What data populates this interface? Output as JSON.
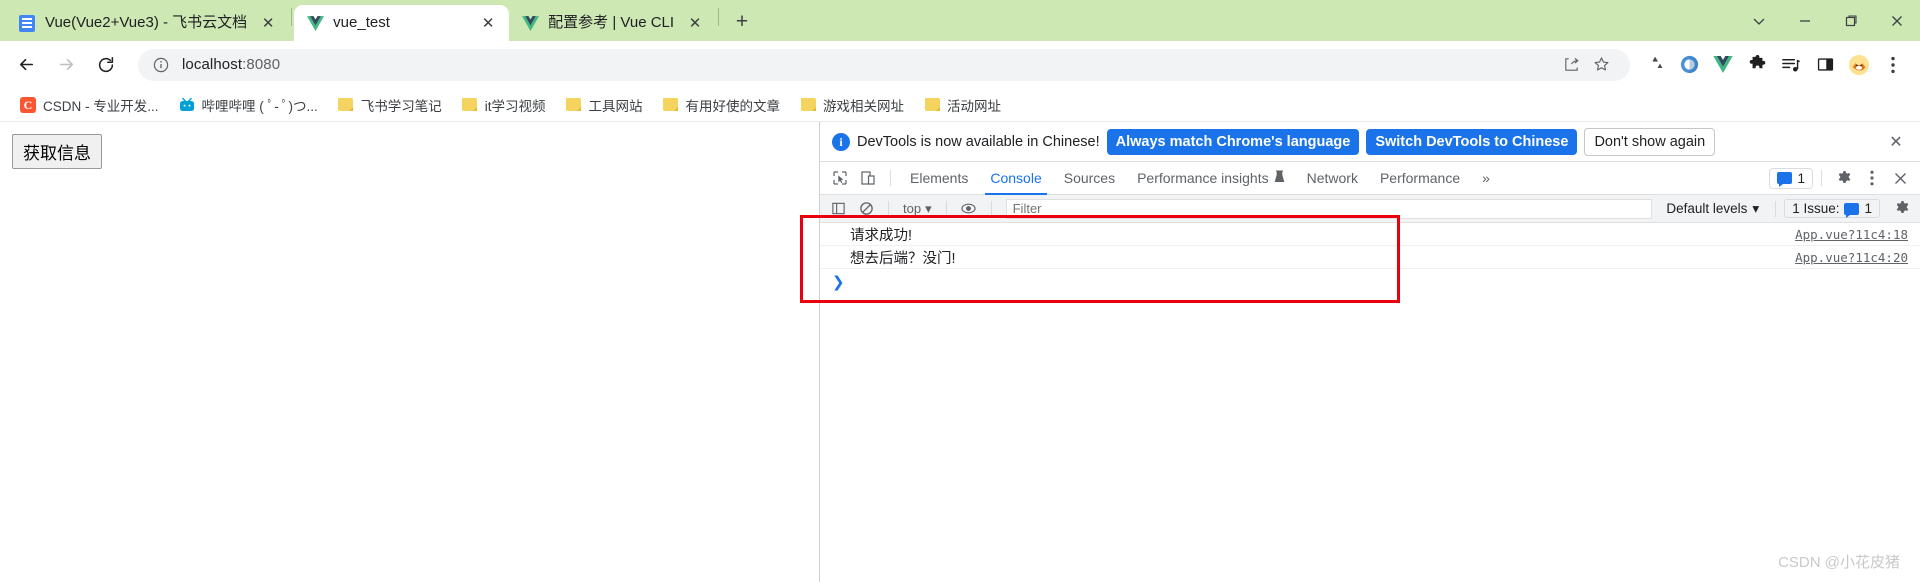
{
  "browser": {
    "tabs": [
      {
        "title": "Vue(Vue2+Vue3) - 飞书云文档",
        "favicon": "doc-icon",
        "active": false
      },
      {
        "title": "vue_test",
        "favicon": "vue-icon",
        "active": true
      },
      {
        "title": "配置参考 | Vue CLI",
        "favicon": "vue-icon",
        "active": false
      }
    ],
    "new_tab_label": "+",
    "window_controls": [
      "chevron-down-icon",
      "minimize-icon",
      "maximize-icon",
      "close-icon"
    ],
    "toolbar": {
      "back_label": "←",
      "forward_label": "→",
      "reload_label": "⟳",
      "url": "localhost:8080",
      "url_host": "localhost",
      "url_port": ":8080",
      "site_info_icon": "info-icon",
      "share_icon": "share-icon",
      "bookmark_icon": "star-icon",
      "extensions": [
        "recycle-icon",
        "omnibox-circle-icon",
        "vue-icon",
        "puzzle-icon",
        "playlist-icon",
        "sidepanel-icon",
        "avatar-icon"
      ],
      "menu_icon": "kebab-menu-icon"
    },
    "bookmarks": [
      {
        "label": "CSDN - 专业开发...",
        "icon": "csdn-icon"
      },
      {
        "label": "哔哩哔哩 ( ﾟ- ﾟ)つ...",
        "icon": "bilibili-icon"
      },
      {
        "label": "飞书学习笔记",
        "icon": "folder-icon"
      },
      {
        "label": "it学习视频",
        "icon": "folder-icon"
      },
      {
        "label": "工具网站",
        "icon": "folder-icon"
      },
      {
        "label": "有用好使的文章",
        "icon": "folder-icon"
      },
      {
        "label": "游戏相关网址",
        "icon": "folder-icon"
      },
      {
        "label": "活动网址",
        "icon": "folder-icon"
      }
    ]
  },
  "page": {
    "button_label": "获取信息"
  },
  "devtools": {
    "banner": {
      "icon": "info-icon",
      "message": "DevTools is now available in Chinese!",
      "primary_button": "Always match Chrome's language",
      "secondary_button": "Switch DevTools to Chinese",
      "tertiary_button": "Don't show again",
      "close_label": "✕"
    },
    "inspect_icon": "inspect-cursor-icon",
    "device_icon": "device-toggle-icon",
    "tabs": [
      {
        "label": "Elements",
        "selected": false
      },
      {
        "label": "Console",
        "selected": true
      },
      {
        "label": "Sources",
        "selected": false
      },
      {
        "label": "Performance insights",
        "selected": false,
        "badge": "experiment-icon"
      },
      {
        "label": "Network",
        "selected": false
      },
      {
        "label": "Performance",
        "selected": false
      }
    ],
    "more_tabs_label": "»",
    "issues_count": "1",
    "settings_icon": "gear-icon",
    "more_icon": "kebab-menu-icon",
    "close_icon": "close-icon",
    "console_bar": {
      "sidebar_icon": "console-sidebar-icon",
      "clear_icon": "clear-console-icon",
      "context": "top",
      "eye_icon": "live-expression-icon",
      "filter_placeholder": "Filter",
      "levels_label": "Default levels",
      "issues_label": "1 Issue:",
      "issues_badge": "1",
      "settings_icon": "gear-icon"
    },
    "logs": [
      {
        "text": "请求成功!",
        "source": "App.vue?11c4:18"
      },
      {
        "text": "想去后端？没门!",
        "source": "App.vue?11c4:20"
      }
    ],
    "prompt": "❯"
  },
  "watermark": "CSDN @小花皮猪",
  "colors": {
    "tab_strip_bg": "#cee8b4",
    "accent_blue": "#1a73e8",
    "annotation_red": "#e8000d"
  }
}
